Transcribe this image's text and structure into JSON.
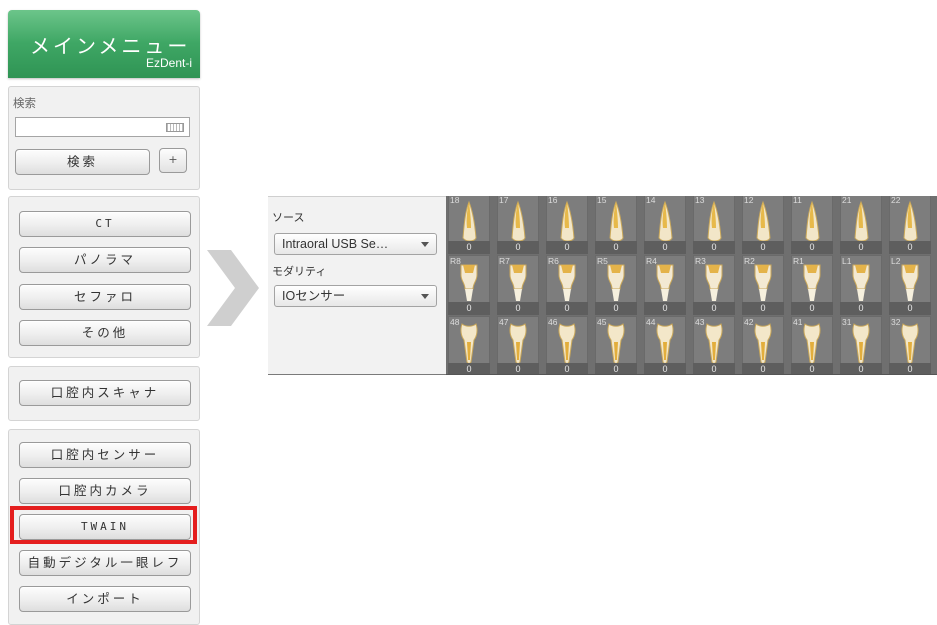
{
  "main_menu": {
    "title": "メインメニュー",
    "brand": "EzDent-i"
  },
  "search": {
    "label": "検索",
    "input_value": "",
    "keyboard_icon": "keyboard-icon",
    "search_button": "検索",
    "plus_button": "+"
  },
  "imaging_group": [
    "CT",
    "パノラマ",
    "セファロ",
    "その他"
  ],
  "scanner_group": [
    "口腔内スキャナ"
  ],
  "device_group": [
    "口腔内センサー",
    "口腔内カメラ",
    "TWAIN",
    "自動デジタル一眼レフ",
    "インポート"
  ],
  "highlighted_item": "TWAIN",
  "colors": {
    "header_green": "#3fa765",
    "highlight_red": "#e41e1e",
    "tooth_grid_bg": "#7d7d7d"
  },
  "acquisition": {
    "source_label": "ソース",
    "source_value": "Intraoral USB Se…",
    "modality_label": "モダリティ",
    "modality_value": "IOセンサー"
  },
  "tooth_rows": [
    {
      "type": "upper",
      "teeth": [
        {
          "num": "18",
          "count": "0"
        },
        {
          "num": "17",
          "count": "0"
        },
        {
          "num": "16",
          "count": "0"
        },
        {
          "num": "15",
          "count": "0"
        },
        {
          "num": "14",
          "count": "0"
        },
        {
          "num": "13",
          "count": "0"
        },
        {
          "num": "12",
          "count": "0"
        },
        {
          "num": "11",
          "count": "0"
        },
        {
          "num": "21",
          "count": "0"
        },
        {
          "num": "22",
          "count": "0"
        }
      ]
    },
    {
      "type": "middle",
      "teeth": [
        {
          "num": "R8",
          "count": "0"
        },
        {
          "num": "R7",
          "count": "0"
        },
        {
          "num": "R6",
          "count": "0"
        },
        {
          "num": "R5",
          "count": "0"
        },
        {
          "num": "R4",
          "count": "0"
        },
        {
          "num": "R3",
          "count": "0"
        },
        {
          "num": "R2",
          "count": "0"
        },
        {
          "num": "R1",
          "count": "0"
        },
        {
          "num": "L1",
          "count": "0"
        },
        {
          "num": "L2",
          "count": "0"
        }
      ]
    },
    {
      "type": "lower",
      "teeth": [
        {
          "num": "48",
          "count": "0"
        },
        {
          "num": "47",
          "count": "0"
        },
        {
          "num": "46",
          "count": "0"
        },
        {
          "num": "45",
          "count": "0"
        },
        {
          "num": "44",
          "count": "0"
        },
        {
          "num": "43",
          "count": "0"
        },
        {
          "num": "42",
          "count": "0"
        },
        {
          "num": "41",
          "count": "0"
        },
        {
          "num": "31",
          "count": "0"
        },
        {
          "num": "32",
          "count": "0"
        }
      ]
    }
  ]
}
